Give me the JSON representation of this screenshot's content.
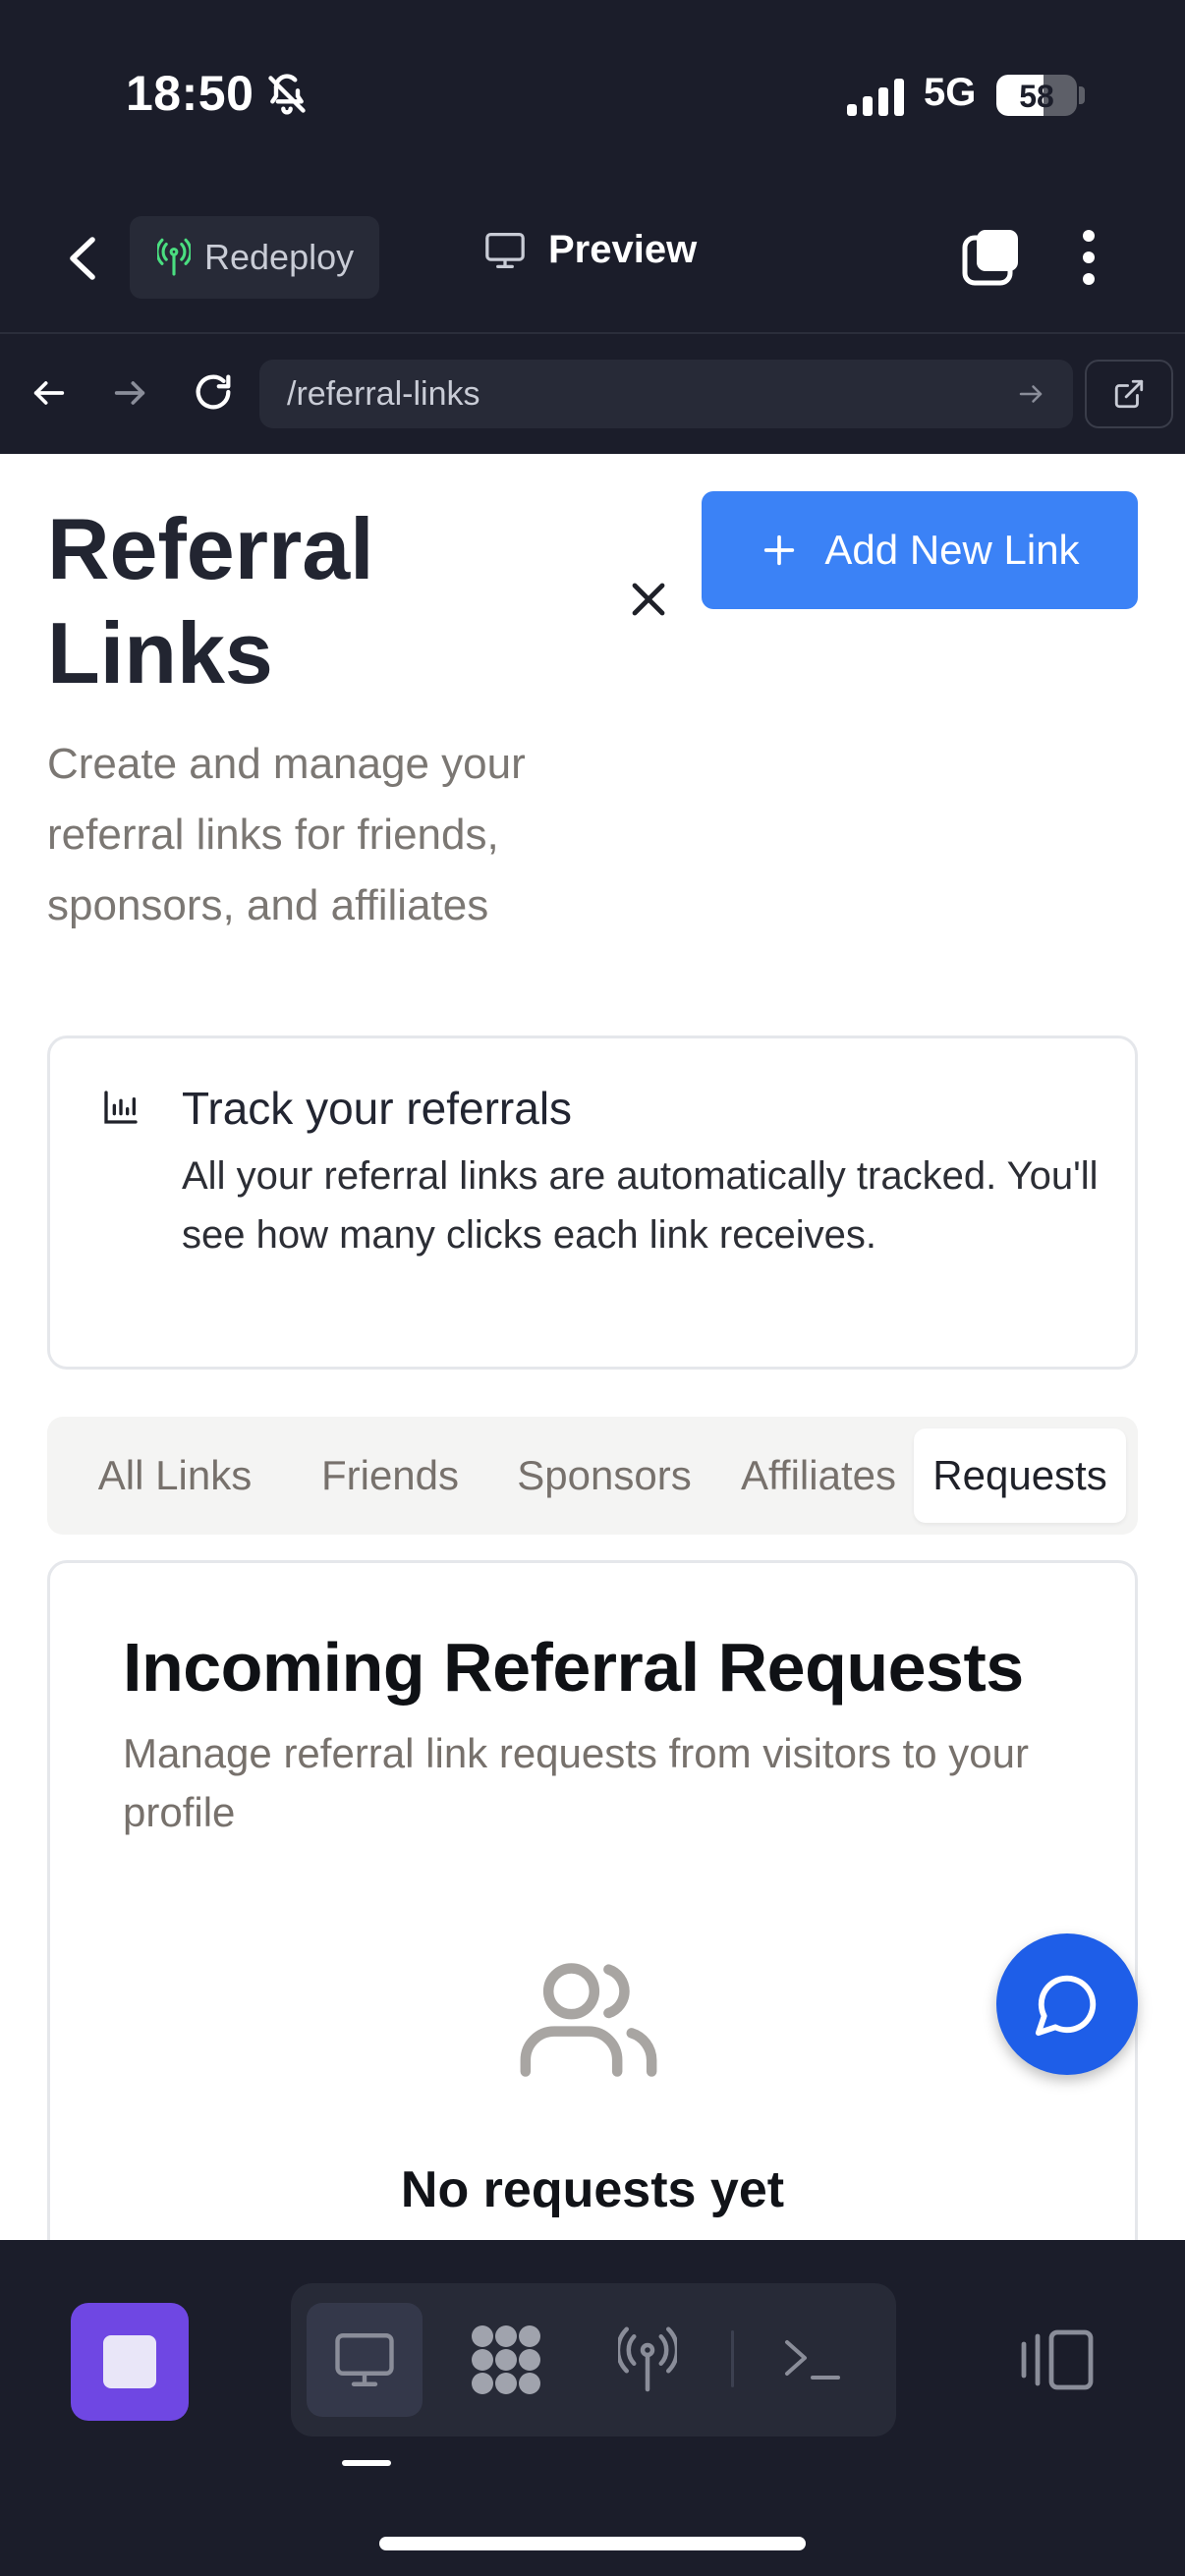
{
  "status_bar": {
    "time": "18:50",
    "network": "5G",
    "battery": "58",
    "battery_level": 0.58,
    "silent_icon": "bell-slash-icon",
    "signal_icon": "signal-bars-icon"
  },
  "app_bar": {
    "back_icon": "chevron-left-icon",
    "redeploy_label": "Redeploy",
    "redeploy_icon": "antenna-icon",
    "preview_label": "Preview",
    "preview_icon": "monitor-icon",
    "tabs_icon": "tabs-icon",
    "menu_icon": "kebab-icon"
  },
  "url_bar": {
    "path": "/referral-links",
    "go_icon": "arrow-right-icon",
    "open_icon": "external-link-icon"
  },
  "page": {
    "title": "Referral Links",
    "subtitle": "Create and manage your referral links for friends, sponsors, and affiliates",
    "add_button": "Add New Link",
    "track": {
      "title": "Track your referrals",
      "body": "All your referral links are automatically tracked. You'll see how many clicks each link receives."
    },
    "tabs": [
      {
        "label": "All Links",
        "active": false
      },
      {
        "label": "Friends",
        "active": false
      },
      {
        "label": "Sponsors",
        "active": false
      },
      {
        "label": "Affiliates",
        "active": false
      },
      {
        "label": "Requests",
        "active": true
      }
    ],
    "requests": {
      "title": "Incoming Referral Requests",
      "subtitle": "Manage referral link requests from visitors to your profile",
      "empty_title": "No requests yet"
    }
  },
  "colors": {
    "accent": "#3b82f6",
    "fab": "#1e5ee8",
    "stop": "#6f47e3",
    "chrome": "#1b1d2a"
  }
}
